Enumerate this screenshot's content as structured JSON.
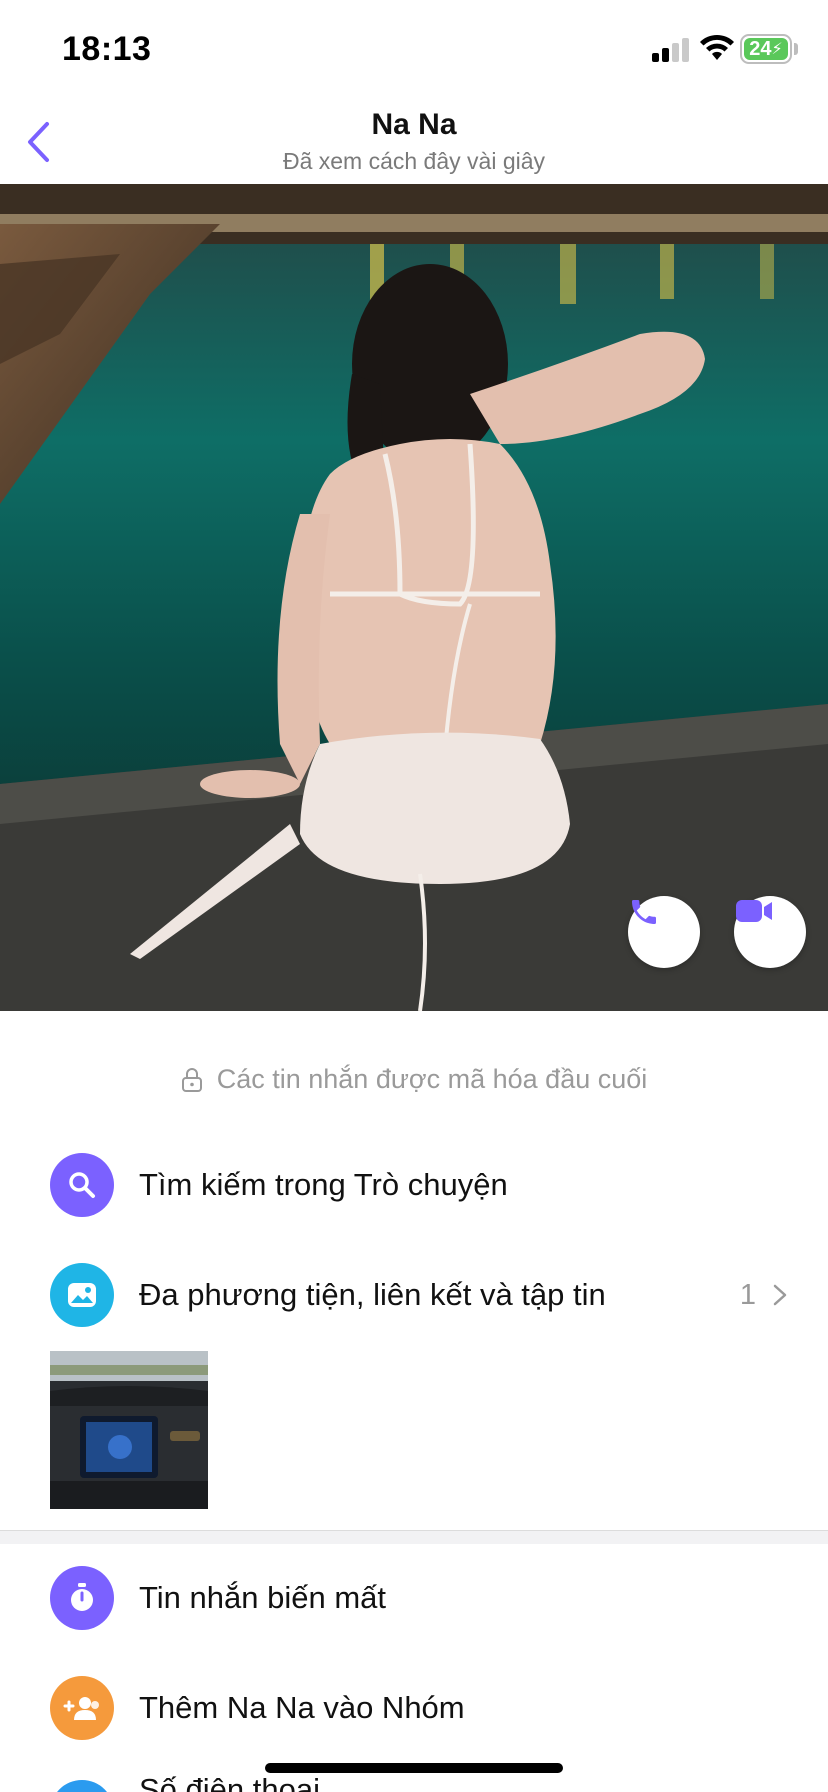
{
  "status_bar": {
    "time": "18:13",
    "battery": "24",
    "icons": [
      "cellular-signal-icon",
      "wifi-icon",
      "battery-charging-icon"
    ]
  },
  "header": {
    "title": "Na Na",
    "subtitle": "Đã xem cách đây vài giây",
    "back_icon": "chevron-left-icon",
    "accent_color": "#7b61ff"
  },
  "cover": {
    "actions": [
      {
        "icon": "phone-icon"
      },
      {
        "icon": "video-camera-icon"
      }
    ]
  },
  "encryption_note": {
    "icon": "lock-icon",
    "text": "Các tin nhắn được mã hóa đầu cuối"
  },
  "menu": {
    "search": {
      "icon": "search-icon",
      "label": "Tìm kiếm trong Trò chuyện",
      "color": "#7b61ff"
    },
    "media": {
      "icon": "gallery-icon",
      "label": "Đa phương tiện, liên kết và tập tin",
      "count": "1",
      "color": "#1fb5e6"
    },
    "disappearing": {
      "icon": "timer-icon",
      "label": "Tin nhắn biến mất",
      "color": "#7b61ff"
    },
    "add_to_group": {
      "icon": "add-group-icon",
      "label": "Thêm Na Na vào Nhóm",
      "color": "#f59a3c"
    },
    "partial_next": {
      "label": "Số điện thoại"
    }
  }
}
